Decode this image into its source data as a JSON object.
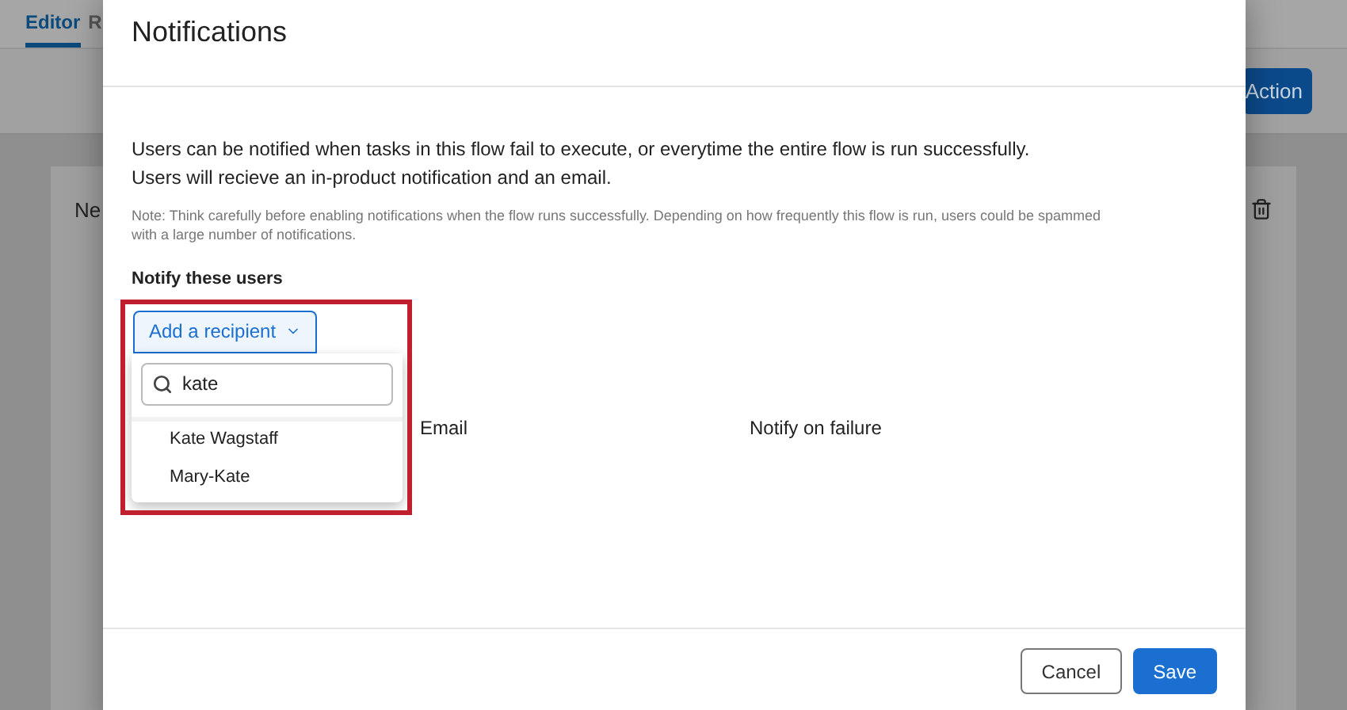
{
  "background": {
    "tabs": [
      {
        "label": "Editor",
        "selected": true
      },
      {
        "label": "R",
        "selected": false
      }
    ],
    "action_button": "Action",
    "card_title": "Ne"
  },
  "modal": {
    "title": "Notifications",
    "description": "Users can be notified when tasks in this flow fail to execute, or everytime the entire flow is run successfully. Users will recieve an in-product notification and an email.",
    "note": "Note: Think carefully before enabling notifications when the flow runs successfully. Depending on how frequently this flow is run, users could be spammed with a large number of notifications.",
    "section_title": "Notify these users",
    "add_button": "Add a recipient",
    "dropdown": {
      "expanded": true,
      "search": {
        "value": "kate"
      },
      "options": [
        "Kate Wagstaff",
        "Mary-Kate"
      ]
    },
    "columns": [
      "Email",
      "Notify on failure"
    ],
    "buttons": {
      "cancel": "Cancel",
      "save": "Save"
    }
  }
}
